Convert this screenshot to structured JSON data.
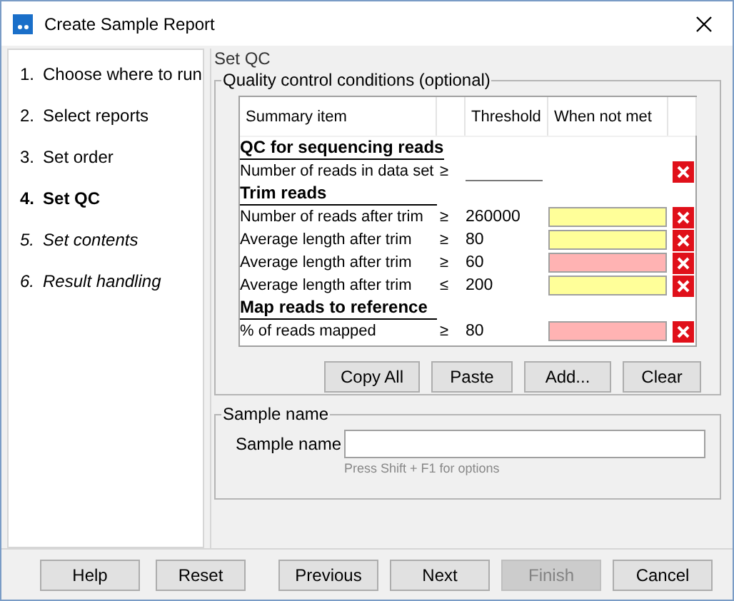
{
  "window": {
    "title": "Create Sample Report"
  },
  "steps": [
    {
      "number": "1.",
      "label": "Choose where to run",
      "kind": "done"
    },
    {
      "number": "2.",
      "label": "Select reports",
      "kind": "done"
    },
    {
      "number": "3.",
      "label": "Set order",
      "kind": "done"
    },
    {
      "number": "4.",
      "label": "Set QC",
      "kind": "current"
    },
    {
      "number": "5.",
      "label": "Set contents",
      "kind": "pending"
    },
    {
      "number": "6.",
      "label": "Result handling",
      "kind": "pending"
    }
  ],
  "page_title": "Set QC",
  "qc": {
    "legend": "Quality control conditions (optional)",
    "columns": [
      "Summary item",
      "Threshold",
      "When not met"
    ],
    "rows": [
      {
        "kind": "section",
        "label": "QC for sequencing reads"
      },
      {
        "kind": "item",
        "label": "Number of reads in data set",
        "operator": "≥"
      },
      {
        "kind": "section",
        "label": "Trim reads"
      },
      {
        "kind": "item",
        "label": "Number of reads after trim",
        "operator": "≥",
        "threshold": "260000",
        "color": "#ffff99"
      },
      {
        "kind": "item",
        "label": "Average length after trim",
        "operator": "≥",
        "threshold": "80",
        "color": "#ffff99"
      },
      {
        "kind": "item",
        "label": "Average length after trim",
        "operator": "≥",
        "threshold": "60",
        "color": "#ffb3b3"
      },
      {
        "kind": "item",
        "label": "Average length after trim",
        "operator": "≤",
        "threshold": "200",
        "color": "#ffff99"
      },
      {
        "kind": "section",
        "label": "Map reads to reference"
      },
      {
        "kind": "item",
        "label": "% of reads mapped",
        "operator": "≥",
        "threshold": "80",
        "color": "#ffb3b3"
      }
    ],
    "buttons": [
      "Copy All",
      "Paste",
      "Add...",
      "Clear"
    ]
  },
  "sample": {
    "legend": "Sample name",
    "label": "Sample name",
    "hint": "Press Shift + F1 for options"
  },
  "footer_buttons": [
    {
      "label": "Help",
      "disabled": false
    },
    {
      "label": "Reset",
      "disabled": false
    },
    {
      "label": "Previous",
      "disabled": false
    },
    {
      "label": "Next",
      "disabled": false
    },
    {
      "label": "Finish",
      "disabled": true
    },
    {
      "label": "Cancel",
      "disabled": false
    }
  ]
}
